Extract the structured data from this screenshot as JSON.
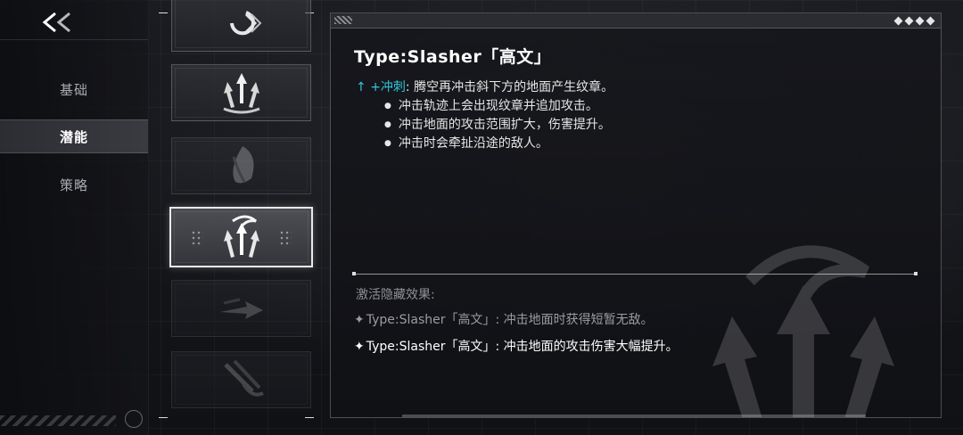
{
  "back_button": {
    "icon": "double-chevron-left-icon",
    "label": "<<"
  },
  "sidebar": {
    "items": [
      {
        "label": "基础",
        "active": false
      },
      {
        "label": "潜能",
        "active": true
      },
      {
        "label": "策略",
        "active": false
      }
    ]
  },
  "potential_slots": [
    {
      "icon": "claw-ring-icon",
      "state": "normal"
    },
    {
      "icon": "triple-arrow-icon",
      "state": "normal"
    },
    {
      "icon": "feather-shield-icon",
      "state": "dim"
    },
    {
      "icon": "flame-arrows-icon",
      "state": "selected"
    },
    {
      "icon": "dash-arrow-icon",
      "state": "dim"
    },
    {
      "icon": "crossed-blades-icon",
      "state": "dim"
    }
  ],
  "detail": {
    "title": "Type:Slasher「高文」",
    "skill": {
      "arrow": "↑",
      "name": "+冲刺",
      "desc": ": 腾空再冲击斜下方的地面产生纹章。"
    },
    "bullets": [
      "冲击轨迹上会出现纹章并追加攻击。",
      "冲击地面的攻击范围扩大，伤害提升。",
      "冲击时会牵扯沿途的敌人。"
    ],
    "hidden_label": "激活隐藏效果:",
    "hidden_effects": [
      {
        "star": "✦",
        "text": "Type:Slasher「高文」: 冲击地面时获得短暂无敌。",
        "active": false
      },
      {
        "star": "✦",
        "text": "Type:Slasher「高文」: 冲击地面的攻击伤害大幅提升。",
        "active": true
      }
    ]
  },
  "colors": {
    "accent": "#2ec8d8",
    "text_primary": "#e6e6e6",
    "text_muted": "#9a9ca1"
  }
}
